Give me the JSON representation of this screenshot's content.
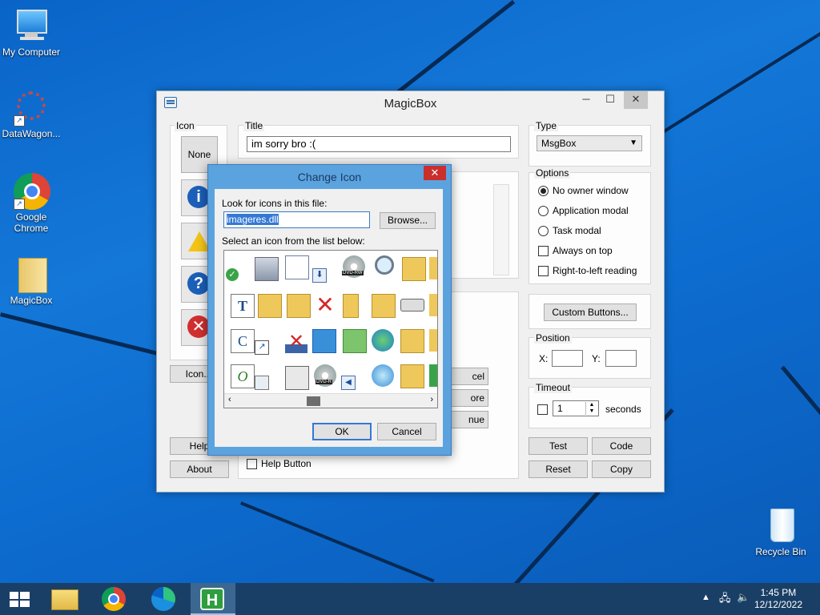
{
  "desktop": {
    "icons": [
      {
        "label": "My Computer"
      },
      {
        "label": "DataWagon..."
      },
      {
        "label": "Google Chrome"
      },
      {
        "label": "MagicBox"
      },
      {
        "label": "Recycle Bin"
      }
    ]
  },
  "magicbox": {
    "title": "MagicBox",
    "icon_group": {
      "label": "Icon",
      "none_label": "None",
      "icon_button_label": "Icon...",
      "help_label": "Help",
      "about_label": "About"
    },
    "title_group": {
      "label": "Title",
      "value": "im sorry bro :("
    },
    "type_group": {
      "label": "Type",
      "selected": "MsgBox"
    },
    "options_group": {
      "label": "Options",
      "items": [
        {
          "label": "No owner window",
          "kind": "radio",
          "checked": true
        },
        {
          "label": "Application modal",
          "kind": "radio",
          "checked": false
        },
        {
          "label": "Task modal",
          "kind": "radio",
          "checked": false
        },
        {
          "label": "Always on top",
          "kind": "check",
          "checked": false
        },
        {
          "label": "Right-to-left reading",
          "kind": "check",
          "checked": false
        }
      ]
    },
    "custom_buttons_label": "Custom Buttons...",
    "position_group": {
      "label": "Position",
      "x_label": "X:",
      "y_label": "Y:",
      "x_value": "",
      "y_value": ""
    },
    "timeout_group": {
      "label": "Timeout",
      "value": "1",
      "unit": "seconds"
    },
    "help_button_label": "Help Button",
    "partial_buttons": [
      "cel",
      "ore",
      "nue"
    ],
    "actions": {
      "test": "Test",
      "code": "Code",
      "reset": "Reset",
      "copy": "Copy"
    }
  },
  "change_icon": {
    "title": "Change Icon",
    "file_label": "Look for icons in this file:",
    "file_value": "imageres.dll",
    "browse_label": "Browse...",
    "list_label": "Select an icon from the list below:",
    "ok_label": "OK",
    "cancel_label": "Cancel",
    "dvd_text": "DVD-RW",
    "dvd_text2": "DVD-R"
  },
  "taskbar": {
    "time": "1:45 PM",
    "date": "12/12/2022"
  },
  "colors": {
    "accent": "#0a64c8",
    "taskbar": "#1a3f66",
    "dialog_frame": "#5ba3df"
  }
}
